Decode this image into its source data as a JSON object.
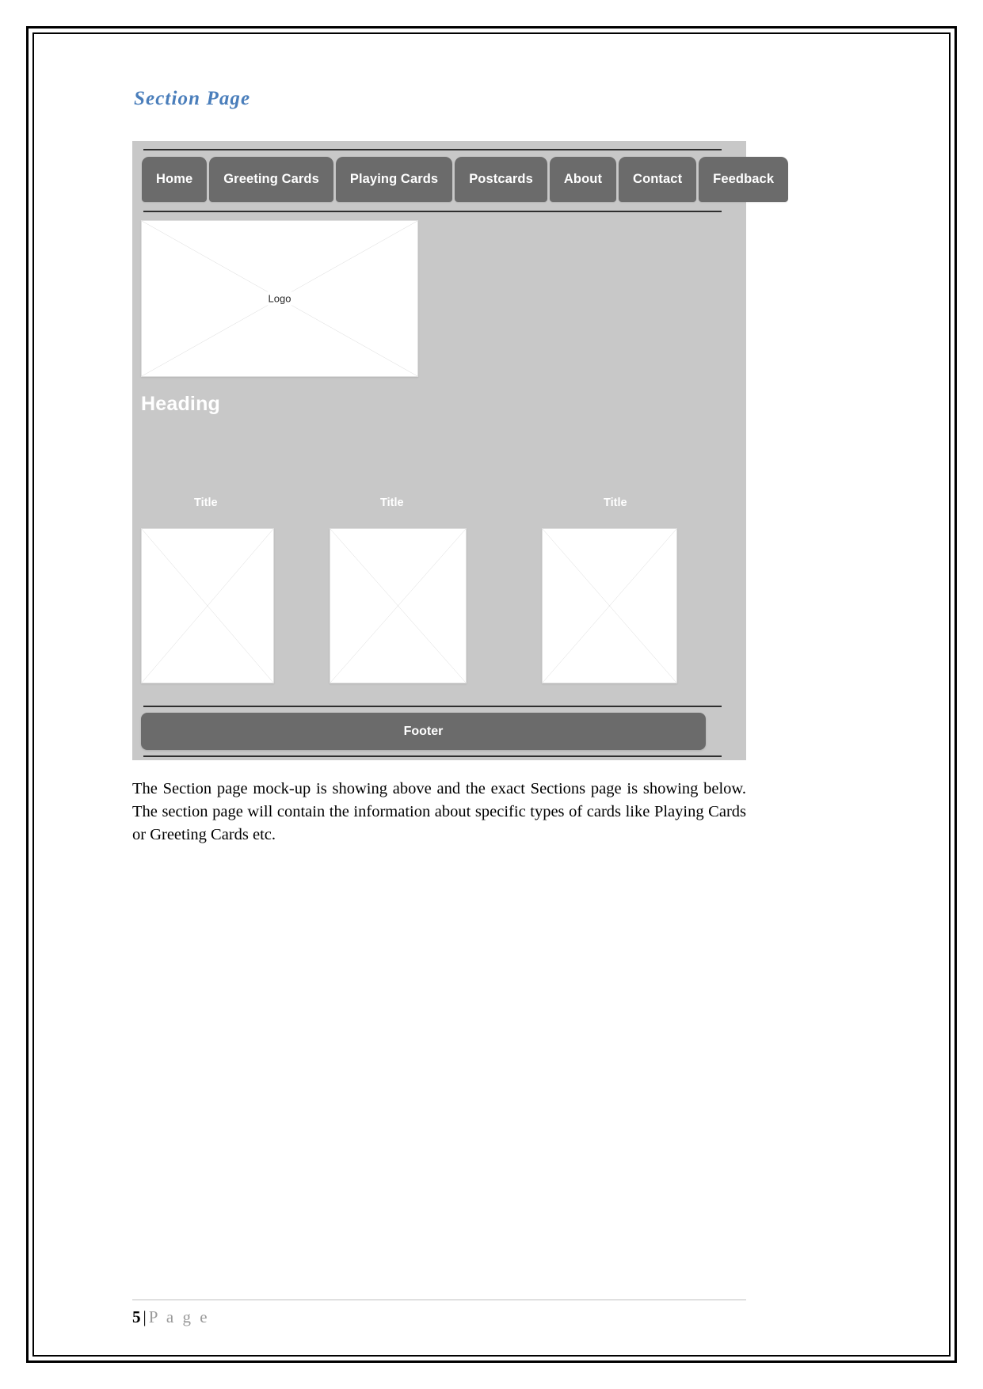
{
  "document": {
    "section_heading": "Section Page",
    "body_paragraph": "The Section page mock-up is showing above and the exact Sections page is showing below. The section page will contain the information about specific types of cards like Playing Cards or Greeting Cards etc.",
    "page_footer": {
      "number": "5",
      "separator": "|",
      "word": "P a g e"
    }
  },
  "mockup": {
    "nav_items": [
      {
        "label": "Home"
      },
      {
        "label": "Greeting Cards"
      },
      {
        "label": "Playing Cards"
      },
      {
        "label": "Postcards"
      },
      {
        "label": "About"
      },
      {
        "label": "Contact"
      },
      {
        "label": "Feedback"
      }
    ],
    "logo_placeholder": {
      "label": "Logo"
    },
    "heading": "Heading",
    "columns": [
      {
        "title": "Title"
      },
      {
        "title": "Title"
      },
      {
        "title": "Title"
      }
    ],
    "footer": {
      "label": "Footer"
    }
  },
  "colors": {
    "heading_blue": "#4a7ebb",
    "mockup_canvas": "#c8c8c8",
    "nav_button": "#6b6b6b",
    "footer_bar": "#6b6b6b",
    "rule_dark": "#2f2f2f",
    "placeholder_fill": "#ffffff",
    "page_border": "#000000"
  }
}
